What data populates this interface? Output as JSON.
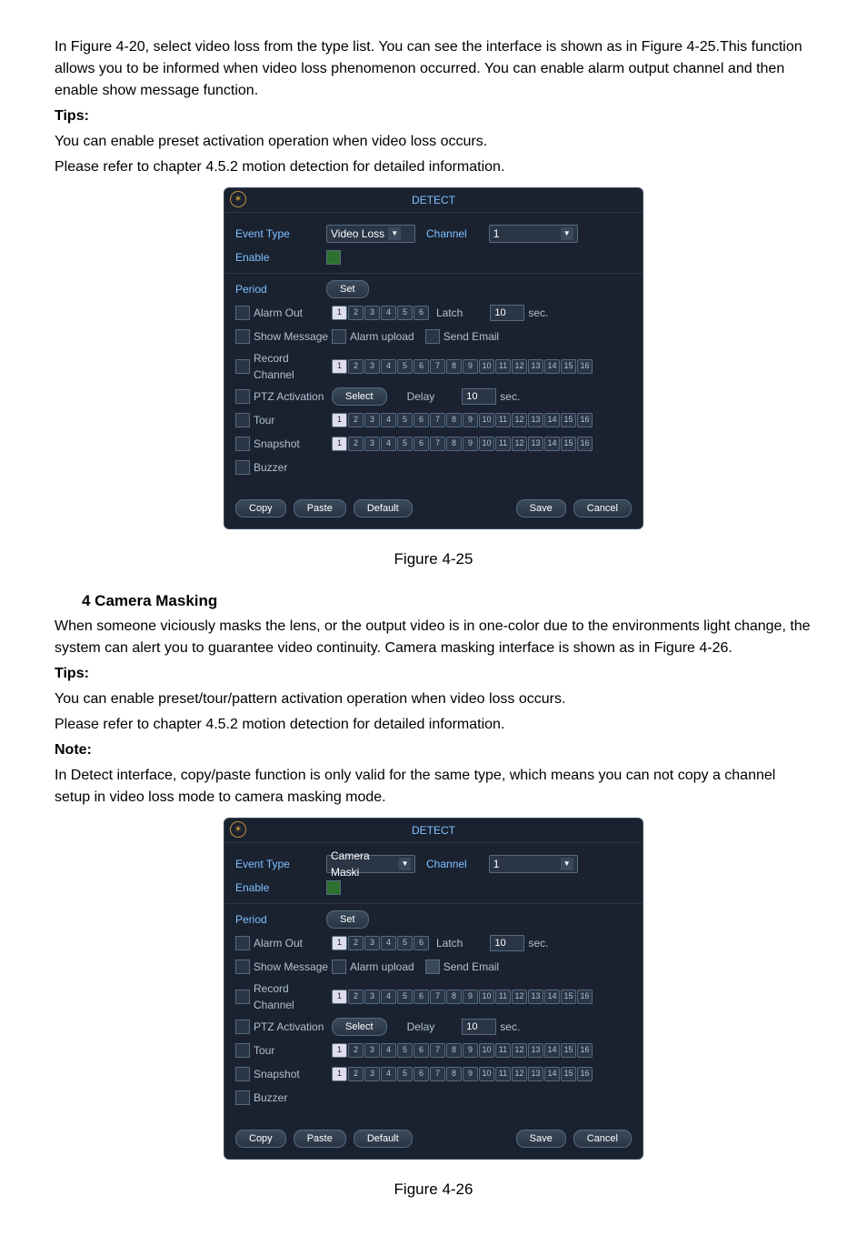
{
  "para1": "In Figure 4-20, select video loss from the type list. You can see the interface is shown as in Figure 4-25.This function allows you to be informed when video loss phenomenon occurred. You can enable alarm output channel and then enable show message function.",
  "tips_label": "Tips:",
  "tips1_line1": "You can enable preset activation operation when video loss occurs.",
  "tips1_line2": "Please refer to chapter 4.5.2 motion detection for detailed information.",
  "fig25_caption": "Figure 4-25",
  "section_title": "4 Camera Masking",
  "para2": "When someone viciously masks the lens, or the output video is in one-color due to the environments light change, the system can alert you to guarantee video continuity. Camera masking interface is shown as in Figure 4-26.",
  "tips2_line1": "You can enable preset/tour/pattern activation operation when video loss occurs.",
  "tips2_line2": "Please refer to chapter 4.5.2 motion detection for detailed information.",
  "note_label": "Note:",
  "note_body": "In Detect interface, copy/paste function is only valid for the same type, which means you can not copy a channel setup in video loss mode to camera masking mode.",
  "fig26_caption": "Figure 4-26",
  "dvr": {
    "title": "DETECT",
    "event_type": "Event Type",
    "enable": "Enable",
    "channel_label": "Channel",
    "video_loss": "Video Loss",
    "camera_mask": "Camera Maski",
    "channel_value": "1",
    "period": "Period",
    "set": "Set",
    "alarm_out": "Alarm Out",
    "latch": "Latch",
    "latch_val": "10",
    "sec": "sec.",
    "show_message": "Show Message",
    "alarm_upload": "Alarm upload",
    "send_email": "Send Email",
    "send_email2": "Send Email",
    "record_channel": "Record Channel",
    "ptz": "PTZ Activation",
    "select": "Select",
    "delay": "Delay",
    "delay_val": "10",
    "tour": "Tour",
    "snapshot": "Snapshot",
    "buzzer": "Buzzer",
    "copy": "Copy",
    "paste": "Paste",
    "default": "Default",
    "save": "Save",
    "cancel": "Cancel"
  }
}
